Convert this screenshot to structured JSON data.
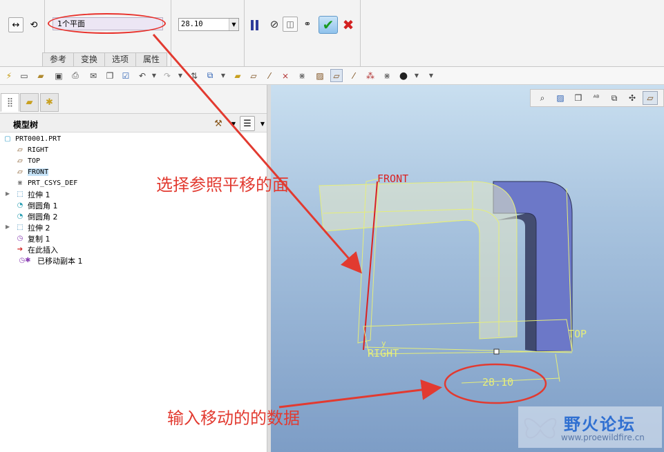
{
  "dashboard": {
    "reference_field": "1个平面",
    "distance_value": "28.10",
    "tabs": [
      "参考",
      "变换",
      "选项",
      "属性"
    ]
  },
  "panel": {
    "title": "模型树"
  },
  "tree": {
    "items": [
      {
        "label": "PRT0001.PRT",
        "icon": "part-icon"
      },
      {
        "label": "RIGHT",
        "icon": "datum-plane-icon"
      },
      {
        "label": "TOP",
        "icon": "datum-plane-icon"
      },
      {
        "label": "FRONT",
        "icon": "datum-plane-icon"
      },
      {
        "label": "PRT_CSYS_DEF",
        "icon": "csys-icon"
      },
      {
        "label": "拉伸 1",
        "icon": "extrude-icon"
      },
      {
        "label": "倒圆角 1",
        "icon": "round-icon"
      },
      {
        "label": "倒圆角 2",
        "icon": "round-icon"
      },
      {
        "label": "拉伸 2",
        "icon": "extrude-icon"
      },
      {
        "label": "复制 1",
        "icon": "copy-icon"
      },
      {
        "label": "在此插入",
        "icon": "insert-here-arrow-icon"
      },
      {
        "label": "已移动副本 1",
        "icon": "moved-copy-icon"
      }
    ]
  },
  "viewport": {
    "plane_labels": {
      "front": "FRONT",
      "right": "RIGHT",
      "top": "TOP"
    },
    "axis_label": "y",
    "dimension": "28.10"
  },
  "annotations": {
    "select_plane": "选择参照平移的面",
    "enter_data": "输入移动的的数据"
  },
  "watermark": {
    "title": "野火论坛",
    "url": "www.proewildfire.cn"
  },
  "colors": {
    "annotation_red": "#e23a30",
    "solid_blue": "#6c78c8",
    "preview_yellow": "#e8ee74",
    "ok_green": "#1a9a20"
  }
}
